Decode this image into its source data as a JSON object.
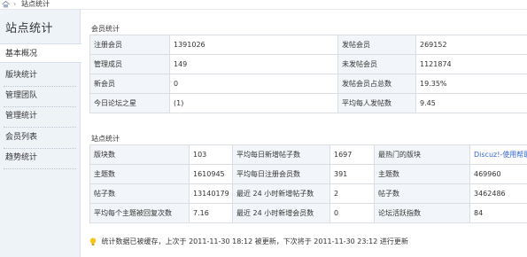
{
  "breadcrumb": {
    "separator": "›",
    "current": "站点统计"
  },
  "sidebar": {
    "title": "站点统计",
    "items": [
      {
        "label": "基本概况"
      },
      {
        "label": "版块统计"
      },
      {
        "label": "管理团队"
      },
      {
        "label": "管理统计"
      },
      {
        "label": "会员列表"
      },
      {
        "label": "趋势统计"
      }
    ]
  },
  "members": {
    "title": "会员统计",
    "rows": [
      [
        "注册会员",
        "1391026",
        "发帖会员",
        "269152"
      ],
      [
        "管理成员",
        "149",
        "未发帖会员",
        "1121874"
      ],
      [
        "新会员",
        "0",
        "发帖会员占总数",
        "19.35%"
      ],
      [
        "今日论坛之星",
        "(1)",
        "平均每人发帖数",
        "9.45"
      ]
    ]
  },
  "site": {
    "title": "站点统计",
    "rows": [
      [
        "版块数",
        "103",
        "平均每日新增帖子数",
        "1697",
        "最热门的版块",
        "Discuz!-使用帮助"
      ],
      [
        "主题数",
        "1610945",
        "平均每日注册会员数",
        "391",
        "主题数",
        "469960"
      ],
      [
        "帖子数",
        "13140179",
        "最近 24 小时新增帖子数",
        "2",
        "帖子数",
        "3462486"
      ],
      [
        "平均每个主题被回复次数",
        "7.16",
        "最近 24 小时新增会员数",
        "0",
        "论坛活跃指数",
        "84"
      ]
    ]
  },
  "footer": {
    "text": "统计数据已被缓存，上次于 2011-11-30 18:12 被更新，下次将于 2011-11-30 23:12 进行更新"
  },
  "colors": {
    "link": "#3366cc",
    "label_bg": "#f2f5f9",
    "sidebar_bg": "#eef3f8"
  }
}
